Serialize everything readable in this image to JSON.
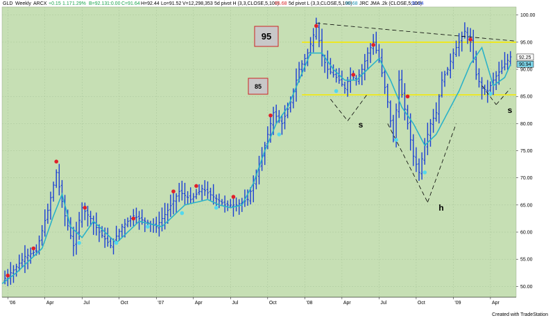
{
  "header": {
    "symbol": "GLD",
    "interval": "Weekly",
    "exchange": "ARCX",
    "change": "+0.15",
    "pct": "1.17",
    "pct2": "1.29%",
    "bid": "B=92.13",
    "bid_chg": "1:0.00",
    "ask": "C=91.64",
    "high": "H=92.44",
    "low": "Lo=91.52",
    "volume": "V=12,298,353",
    "ind1": "5d pivot H (3,3,CLOSE,5,100)",
    "ind1_val": "95.68",
    "ind2": "5d pivot L (3,3,CLOSE,5,100)",
    "ind2_val": "99.68",
    "ind3": "JRC JMA .2k (CLOSE,5,100)",
    "ind3_val": "90.94"
  },
  "footer": {
    "credit": "Created with TradeStation"
  },
  "annotations": {
    "box95": "95",
    "box85": "85",
    "s_left": "s",
    "h": "h",
    "s_right": "s"
  },
  "price_tags": {
    "last": "92.25",
    "jma": "90.94",
    "last_color": "#ffffff",
    "jma_color": "#7fd6ea"
  },
  "colors": {
    "background": "#c6dfb4",
    "bars": "#1a3ed4",
    "jma_line": "#2bb2c8",
    "pivot_high": "#e0202a",
    "pivot_low": "#54d8ee",
    "level_lines": "#f6ea00",
    "trend_lines": "#000000"
  },
  "chart_data": {
    "type": "line",
    "title": "GLD - Weekly ARCX",
    "xlabel": "",
    "ylabel": "",
    "ylim": [
      48,
      101.5
    ],
    "yticks": [
      50.0,
      55.0,
      60.0,
      65.0,
      70.0,
      75.0,
      80.0,
      85.0,
      90.0,
      95.0,
      100.0
    ],
    "xtick_labels": [
      "'06",
      "Apr",
      "Jul",
      "Oct",
      "'07",
      "Apr",
      "Jul",
      "Oct",
      "'08",
      "Apr",
      "Jul",
      "Oct",
      "'09",
      "Apr"
    ],
    "x_range_weeks": [
      -2,
      178
    ],
    "xtick_weeks": [
      0,
      13,
      26,
      39,
      52,
      65,
      78,
      91,
      104,
      117,
      130,
      143,
      156,
      169
    ],
    "series": [
      {
        "key": "close",
        "x_weeks": [
          -2,
          2,
          6,
          10,
          14,
          17,
          20,
          23,
          26,
          29,
          32,
          36,
          40,
          44,
          48,
          52,
          56,
          60,
          64,
          68,
          72,
          76,
          80,
          84,
          88,
          91,
          93,
          96,
          99,
          102,
          105,
          108,
          110,
          112,
          114,
          116,
          118,
          120,
          122,
          124,
          126,
          128,
          130,
          133,
          135,
          137,
          140,
          142,
          144,
          146,
          148,
          150,
          152,
          154,
          156,
          158,
          160,
          162,
          164,
          166,
          168,
          170,
          172,
          174,
          176
        ],
        "values": [
          51,
          53,
          55.5,
          56.5,
          64,
          71,
          63,
          57.5,
          64.5,
          62.5,
          60,
          57.5,
          61,
          63,
          62,
          61,
          64,
          67.5,
          66,
          68,
          66.5,
          65,
          65,
          66,
          72,
          78,
          82,
          80,
          84,
          90,
          93,
          98,
          92.5,
          90,
          89,
          88,
          86.5,
          89,
          88,
          90,
          93,
          95,
          92,
          84,
          77,
          88,
          80,
          74,
          71,
          76,
          80,
          82,
          88,
          90,
          93,
          95,
          97,
          95,
          89,
          86.5,
          86,
          88,
          89.5,
          91,
          92.3
        ]
      },
      {
        "key": "jma",
        "x_weeks": [
          -2,
          3,
          8,
          12,
          16,
          19,
          22,
          26,
          30,
          34,
          38,
          42,
          46,
          50,
          54,
          58,
          62,
          66,
          70,
          74,
          78,
          82,
          86,
          90,
          94,
          98,
          102,
          106,
          110,
          114,
          118,
          122,
          126,
          130,
          134,
          138,
          142,
          146,
          150,
          154,
          158,
          162,
          166,
          170,
          174,
          176
        ],
        "values": [
          50.5,
          52.5,
          55,
          57,
          63,
          67,
          61,
          59,
          62,
          60,
          58,
          60,
          62,
          61.5,
          61,
          63,
          65,
          65.5,
          66,
          65,
          64.5,
          65,
          69,
          75,
          80,
          83,
          88,
          93,
          93,
          90,
          88,
          88,
          90,
          92,
          88,
          83,
          80,
          76,
          78,
          82,
          86,
          91,
          94,
          87,
          88.5,
          90.9
        ]
      }
    ],
    "pivot_highs": [
      {
        "x": 0,
        "y": 52
      },
      {
        "x": 9,
        "y": 57
      },
      {
        "x": 17,
        "y": 73
      },
      {
        "x": 27,
        "y": 64.5
      },
      {
        "x": 44,
        "y": 62.5
      },
      {
        "x": 58,
        "y": 67.5
      },
      {
        "x": 66,
        "y": 68.5
      },
      {
        "x": 79,
        "y": 66.5
      },
      {
        "x": 92,
        "y": 81.5
      },
      {
        "x": 108,
        "y": 98
      },
      {
        "x": 121,
        "y": 89
      },
      {
        "x": 128,
        "y": 94.5
      },
      {
        "x": 140,
        "y": 85
      },
      {
        "x": 162,
        "y": 95.5
      }
    ],
    "pivot_lows": [
      {
        "x": 25,
        "y": 58
      },
      {
        "x": 38,
        "y": 58
      },
      {
        "x": 49,
        "y": 61
      },
      {
        "x": 61,
        "y": 63.5
      },
      {
        "x": 73,
        "y": 64.5
      },
      {
        "x": 95,
        "y": 78
      },
      {
        "x": 115,
        "y": 86
      },
      {
        "x": 136,
        "y": 77
      },
      {
        "x": 146,
        "y": 71
      },
      {
        "x": 169,
        "y": 85.5
      }
    ],
    "horizontal_levels": [
      95,
      85.3
    ],
    "trendlines": [
      {
        "x1": 108,
        "y1": 98.5,
        "x2": 178,
        "y2": 95.2
      },
      {
        "x1": 113,
        "y1": 84.5,
        "x2": 119,
        "y2": 80.5
      },
      {
        "x1": 119,
        "y1": 80.5,
        "x2": 126,
        "y2": 85.5
      },
      {
        "x1": 133,
        "y1": 80,
        "x2": 147,
        "y2": 65.5
      },
      {
        "x1": 147,
        "y1": 65.5,
        "x2": 157,
        "y2": 80
      },
      {
        "x1": 166,
        "y1": 87,
        "x2": 171,
        "y2": 83.5
      },
      {
        "x1": 171,
        "y1": 83.5,
        "x2": 176,
        "y2": 86.5
      }
    ]
  }
}
